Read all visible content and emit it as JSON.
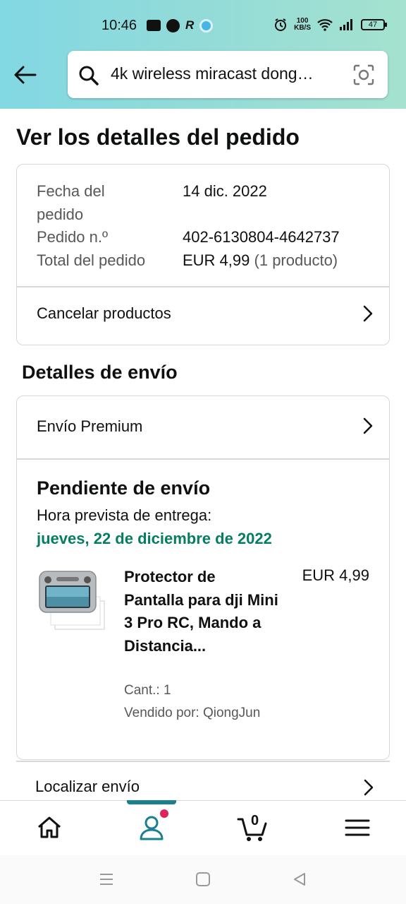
{
  "status_bar": {
    "time": "10:46",
    "speed_top": "100",
    "speed_unit": "KB/S",
    "battery": "47"
  },
  "search": {
    "query": "4k wireless miracast dong…"
  },
  "page": {
    "title": "Ver los detalles del pedido"
  },
  "order": {
    "date_label": "Fecha del pedido",
    "date_value": "14 dic. 2022",
    "number_label": "Pedido n.º",
    "number_value": "402-6130804-4642737",
    "total_label": "Total del pedido",
    "total_value": "EUR 4,99",
    "total_count": "(1 producto)",
    "cancel_label": "Cancelar productos"
  },
  "shipping": {
    "section_title": "Detalles de envío",
    "method": "Envío Premium",
    "status": "Pendiente de envío",
    "eta_label": "Hora prevista de entrega:",
    "eta_date": "jueves, 22 de diciembre de 2022",
    "track_label": "Localizar envío"
  },
  "item": {
    "name": "Protector de Pantalla para dji Mini 3 Pro RC, Mando a Distancia...",
    "price": "EUR 4,99",
    "qty": "Cant.: 1",
    "seller": "Vendido por: QiongJun"
  },
  "bottom_nav": {
    "cart_count": "0",
    "items": [
      "home-icon",
      "account-icon",
      "cart-icon",
      "menu-icon"
    ]
  },
  "colors": {
    "accent_teal": "#1a7f8e",
    "delivery_green": "#067d62",
    "notification_pink": "#e0235a"
  }
}
